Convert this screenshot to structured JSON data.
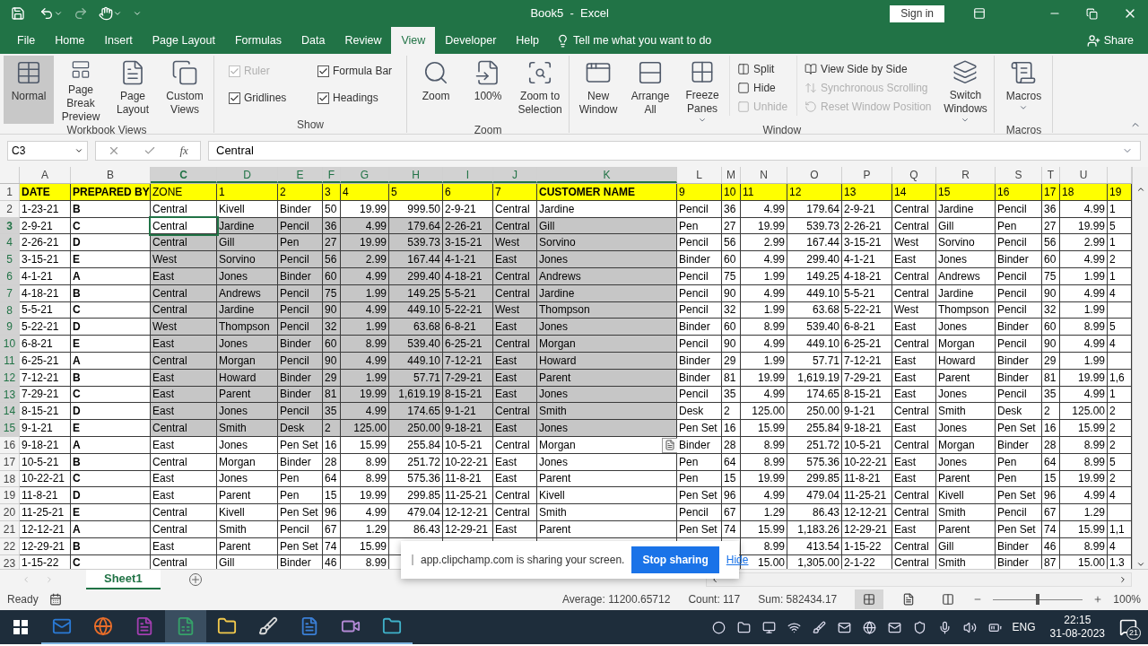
{
  "title_bar": {
    "title": "Book5  -  Excel",
    "sign_in": "Sign in"
  },
  "menu_tabs": [
    {
      "label": "File",
      "selected": false
    },
    {
      "label": "Home",
      "selected": false
    },
    {
      "label": "Insert",
      "selected": false
    },
    {
      "label": "Page Layout",
      "selected": false
    },
    {
      "label": "Formulas",
      "selected": false
    },
    {
      "label": "Data",
      "selected": false
    },
    {
      "label": "Review",
      "selected": false
    },
    {
      "label": "View",
      "selected": true
    },
    {
      "label": "Developer",
      "selected": false
    },
    {
      "label": "Help",
      "selected": false
    }
  ],
  "tell_me": "Tell me what you want to do",
  "share": "Share",
  "ribbon": [
    {
      "label": "Workbook Views",
      "items": [
        {
          "kind": "large",
          "label": "Normal",
          "selected": true
        },
        {
          "kind": "large",
          "label": "Page Break Preview",
          "selected": false
        },
        {
          "kind": "large",
          "label": "Page Layout",
          "selected": false
        },
        {
          "kind": "large",
          "label": "Custom Views",
          "selected": false
        }
      ]
    },
    {
      "label": "Show",
      "items": [
        {
          "kind": "check",
          "label": "Ruler",
          "checked": true,
          "disabled": true
        },
        {
          "kind": "check",
          "label": "Formula Bar",
          "checked": true,
          "disabled": false
        },
        {
          "kind": "check",
          "label": "Gridlines",
          "checked": true,
          "disabled": false
        },
        {
          "kind": "check",
          "label": "Headings",
          "checked": true,
          "disabled": false
        }
      ]
    },
    {
      "label": "Zoom",
      "items": [
        {
          "kind": "large",
          "label": "Zoom",
          "selected": false
        },
        {
          "kind": "large",
          "label": "100%",
          "selected": false
        },
        {
          "kind": "large",
          "label": "Zoom to Selection",
          "selected": false
        }
      ]
    },
    {
      "label": "Window",
      "items": [
        {
          "kind": "large",
          "label": "New Window",
          "selected": false
        },
        {
          "kind": "large",
          "label": "Arrange All",
          "selected": false
        },
        {
          "kind": "large",
          "label": "Freeze Panes",
          "selected": false,
          "dropdown": true
        },
        {
          "kind": "small",
          "label": "Split",
          "disabled": false
        },
        {
          "kind": "small",
          "label": "Hide",
          "disabled": false
        },
        {
          "kind": "small",
          "label": "Unhide",
          "disabled": true
        },
        {
          "kind": "small",
          "label": "View Side by Side",
          "disabled": false
        },
        {
          "kind": "small",
          "label": "Synchronous Scrolling",
          "disabled": true
        },
        {
          "kind": "small",
          "label": "Reset Window Position",
          "disabled": true
        },
        {
          "kind": "large",
          "label": "Switch Windows",
          "selected": false,
          "dropdown": true
        }
      ]
    },
    {
      "label": "Macros",
      "items": [
        {
          "kind": "large",
          "label": "Macros",
          "selected": false,
          "dropdown": true
        }
      ]
    }
  ],
  "formula_bar": {
    "name_box": "C3",
    "function_label": "fx",
    "formula": "Central"
  },
  "columns": [
    {
      "letter": "A",
      "selected": false,
      "active": false
    },
    {
      "letter": "B",
      "selected": false,
      "active": false
    },
    {
      "letter": "C",
      "selected": true,
      "active": true
    },
    {
      "letter": "D",
      "selected": true,
      "active": false
    },
    {
      "letter": "E",
      "selected": true,
      "active": false
    },
    {
      "letter": "F",
      "selected": true,
      "active": false
    },
    {
      "letter": "G",
      "selected": true,
      "active": false
    },
    {
      "letter": "H",
      "selected": true,
      "active": false
    },
    {
      "letter": "I",
      "selected": true,
      "active": false
    },
    {
      "letter": "J",
      "selected": true,
      "active": false
    },
    {
      "letter": "K",
      "selected": true,
      "active": false
    },
    {
      "letter": "L",
      "selected": false,
      "active": false
    },
    {
      "letter": "M",
      "selected": false,
      "active": false
    },
    {
      "letter": "N",
      "selected": false,
      "active": false
    },
    {
      "letter": "O",
      "selected": false,
      "active": false
    },
    {
      "letter": "P",
      "selected": false,
      "active": false
    },
    {
      "letter": "Q",
      "selected": false,
      "active": false
    },
    {
      "letter": "R",
      "selected": false,
      "active": false
    },
    {
      "letter": "S",
      "selected": false,
      "active": false
    },
    {
      "letter": "T",
      "selected": false,
      "active": false
    },
    {
      "letter": "U",
      "selected": false,
      "active": false
    }
  ],
  "rows": [
    {
      "number": "1",
      "kind": "header",
      "selected": false,
      "active": false,
      "cells": [
        "DATE",
        "PREPARED BY",
        "ZONE",
        "1",
        "2",
        "3",
        "4",
        "5",
        "6",
        "7",
        "CUSTOMER NAME",
        "9",
        "10",
        "11",
        "12",
        "13",
        "14",
        "15",
        "16",
        "17",
        "18",
        "19"
      ]
    },
    {
      "number": "2",
      "kind": "data",
      "selected": false,
      "active": false,
      "cells": [
        "1-23-21",
        "B",
        "Central",
        "Kivell",
        "Binder",
        "50",
        "19.99",
        "999.50",
        "2-9-21",
        "Central",
        "Jardine",
        "Pencil",
        "36",
        "4.99",
        "179.64",
        "2-9-21",
        "Central",
        "Jardine",
        "Pencil",
        "36",
        "4.99",
        "1"
      ]
    },
    {
      "number": "3",
      "kind": "data",
      "selected": true,
      "active": true,
      "cells": [
        "2-9-21",
        "C",
        "Central",
        "Jardine",
        "Pencil",
        "36",
        "4.99",
        "179.64",
        "2-26-21",
        "Central",
        "Gill",
        "Pen",
        "27",
        "19.99",
        "539.73",
        "2-26-21",
        "Central",
        "Gill",
        "Pen",
        "27",
        "19.99",
        "5"
      ]
    },
    {
      "number": "4",
      "kind": "data",
      "selected": true,
      "active": false,
      "cells": [
        "2-26-21",
        "D",
        "Central",
        "Gill",
        "Pen",
        "27",
        "19.99",
        "539.73",
        "3-15-21",
        "West",
        "Sorvino",
        "Pencil",
        "56",
        "2.99",
        "167.44",
        "3-15-21",
        "West",
        "Sorvino",
        "Pencil",
        "56",
        "2.99",
        "1"
      ]
    },
    {
      "number": "5",
      "kind": "data",
      "selected": true,
      "active": false,
      "cells": [
        "3-15-21",
        "E",
        "West",
        "Sorvino",
        "Pencil",
        "56",
        "2.99",
        "167.44",
        "4-1-21",
        "East",
        "Jones",
        "Binder",
        "60",
        "4.99",
        "299.40",
        "4-1-21",
        "East",
        "Jones",
        "Binder",
        "60",
        "4.99",
        "2"
      ]
    },
    {
      "number": "6",
      "kind": "data",
      "selected": true,
      "active": false,
      "cells": [
        "4-1-21",
        "A",
        "East",
        "Jones",
        "Binder",
        "60",
        "4.99",
        "299.40",
        "4-18-21",
        "Central",
        "Andrews",
        "Pencil",
        "75",
        "1.99",
        "149.25",
        "4-18-21",
        "Central",
        "Andrews",
        "Pencil",
        "75",
        "1.99",
        "1"
      ]
    },
    {
      "number": "7",
      "kind": "data",
      "selected": true,
      "active": false,
      "cells": [
        "4-18-21",
        "B",
        "Central",
        "Andrews",
        "Pencil",
        "75",
        "1.99",
        "149.25",
        "5-5-21",
        "Central",
        "Jardine",
        "Pencil",
        "90",
        "4.99",
        "449.10",
        "5-5-21",
        "Central",
        "Jardine",
        "Pencil",
        "90",
        "4.99",
        "4"
      ]
    },
    {
      "number": "8",
      "kind": "data",
      "selected": true,
      "active": false,
      "cells": [
        "5-5-21",
        "C",
        "Central",
        "Jardine",
        "Pencil",
        "90",
        "4.99",
        "449.10",
        "5-22-21",
        "West",
        "Thompson",
        "Pencil",
        "32",
        "1.99",
        "63.68",
        "5-22-21",
        "West",
        "Thompson",
        "Pencil",
        "32",
        "1.99",
        null
      ]
    },
    {
      "number": "9",
      "kind": "data",
      "selected": true,
      "active": false,
      "cells": [
        "5-22-21",
        "D",
        "West",
        "Thompson",
        "Pencil",
        "32",
        "1.99",
        "63.68",
        "6-8-21",
        "East",
        "Jones",
        "Binder",
        "60",
        "8.99",
        "539.40",
        "6-8-21",
        "East",
        "Jones",
        "Binder",
        "60",
        "8.99",
        "5"
      ]
    },
    {
      "number": "10",
      "kind": "data",
      "selected": true,
      "active": false,
      "cells": [
        "6-8-21",
        "E",
        "East",
        "Jones",
        "Binder",
        "60",
        "8.99",
        "539.40",
        "6-25-21",
        "Central",
        "Morgan",
        "Pencil",
        "90",
        "4.99",
        "449.10",
        "6-25-21",
        "Central",
        "Morgan",
        "Pencil",
        "90",
        "4.99",
        "4"
      ]
    },
    {
      "number": "11",
      "kind": "data",
      "selected": true,
      "active": false,
      "cells": [
        "6-25-21",
        "A",
        "Central",
        "Morgan",
        "Pencil",
        "90",
        "4.99",
        "449.10",
        "7-12-21",
        "East",
        "Howard",
        "Binder",
        "29",
        "1.99",
        "57.71",
        "7-12-21",
        "East",
        "Howard",
        "Binder",
        "29",
        "1.99",
        null
      ]
    },
    {
      "number": "12",
      "kind": "data",
      "selected": true,
      "active": false,
      "cells": [
        "7-12-21",
        "B",
        "East",
        "Howard",
        "Binder",
        "29",
        "1.99",
        "57.71",
        "7-29-21",
        "East",
        "Parent",
        "Binder",
        "81",
        "19.99",
        "1,619.19",
        "7-29-21",
        "East",
        "Parent",
        "Binder",
        "81",
        "19.99",
        "1,6"
      ]
    },
    {
      "number": "13",
      "kind": "data",
      "selected": true,
      "active": false,
      "cells": [
        "7-29-21",
        "C",
        "East",
        "Parent",
        "Binder",
        "81",
        "19.99",
        "1,619.19",
        "8-15-21",
        "East",
        "Jones",
        "Pencil",
        "35",
        "4.99",
        "174.65",
        "8-15-21",
        "East",
        "Jones",
        "Pencil",
        "35",
        "4.99",
        "1"
      ]
    },
    {
      "number": "14",
      "kind": "data",
      "selected": true,
      "active": false,
      "cells": [
        "8-15-21",
        "D",
        "East",
        "Jones",
        "Pencil",
        "35",
        "4.99",
        "174.65",
        "9-1-21",
        "Central",
        "Smith",
        "Desk",
        "2",
        "125.00",
        "250.00",
        "9-1-21",
        "Central",
        "Smith",
        "Desk",
        "2",
        "125.00",
        "2"
      ]
    },
    {
      "number": "15",
      "kind": "data",
      "selected": true,
      "active": false,
      "cells": [
        "9-1-21",
        "E",
        "Central",
        "Smith",
        "Desk",
        "2",
        "125.00",
        "250.00",
        "9-18-21",
        "East",
        "Jones",
        "Pen Set",
        "16",
        "15.99",
        "255.84",
        "9-18-21",
        "East",
        "Jones",
        "Pen Set",
        "16",
        "15.99",
        "2"
      ]
    },
    {
      "number": "16",
      "kind": "data",
      "selected": false,
      "active": false,
      "paste_options": true,
      "cells": [
        "9-18-21",
        "A",
        "East",
        "Jones",
        "Pen Set",
        "16",
        "15.99",
        "255.84",
        "10-5-21",
        "Central",
        "Morgan",
        "Binder",
        "28",
        "8.99",
        "251.72",
        "10-5-21",
        "Central",
        "Morgan",
        "Binder",
        "28",
        "8.99",
        "2"
      ]
    },
    {
      "number": "17",
      "kind": "data",
      "selected": false,
      "active": false,
      "cells": [
        "10-5-21",
        "B",
        "Central",
        "Morgan",
        "Binder",
        "28",
        "8.99",
        "251.72",
        "10-22-21",
        "East",
        "Jones",
        "Pen",
        "64",
        "8.99",
        "575.36",
        "10-22-21",
        "East",
        "Jones",
        "Pen",
        "64",
        "8.99",
        "5"
      ]
    },
    {
      "number": "18",
      "kind": "data",
      "selected": false,
      "active": false,
      "cells": [
        "10-22-21",
        "C",
        "East",
        "Jones",
        "Pen",
        "64",
        "8.99",
        "575.36",
        "11-8-21",
        "East",
        "Parent",
        "Pen",
        "15",
        "19.99",
        "299.85",
        "11-8-21",
        "East",
        "Parent",
        "Pen",
        "15",
        "19.99",
        "2"
      ]
    },
    {
      "number": "19",
      "kind": "data",
      "selected": false,
      "active": false,
      "cells": [
        "11-8-21",
        "D",
        "East",
        "Parent",
        "Pen",
        "15",
        "19.99",
        "299.85",
        "11-25-21",
        "Central",
        "Kivell",
        "Pen Set",
        "96",
        "4.99",
        "479.04",
        "11-25-21",
        "Central",
        "Kivell",
        "Pen Set",
        "96",
        "4.99",
        "4"
      ]
    },
    {
      "number": "20",
      "kind": "data",
      "selected": false,
      "active": false,
      "cells": [
        "11-25-21",
        "E",
        "Central",
        "Kivell",
        "Pen Set",
        "96",
        "4.99",
        "479.04",
        "12-12-21",
        "Central",
        "Smith",
        "Pencil",
        "67",
        "1.29",
        "86.43",
        "12-12-21",
        "Central",
        "Smith",
        "Pencil",
        "67",
        "1.29",
        null
      ]
    },
    {
      "number": "21",
      "kind": "data",
      "selected": false,
      "active": false,
      "cells": [
        "12-12-21",
        "A",
        "Central",
        "Smith",
        "Pencil",
        "67",
        "1.29",
        "86.43",
        "12-29-21",
        "East",
        "Parent",
        "Pen Set",
        "74",
        "15.99",
        "1,183.26",
        "12-29-21",
        "East",
        "Parent",
        "Pen Set",
        "74",
        "15.99",
        "1,1"
      ]
    },
    {
      "number": "22",
      "kind": "data",
      "selected": false,
      "active": false,
      "cells": [
        "12-29-21",
        "B",
        "East",
        "Parent",
        "Pen Set",
        "74",
        "15.99",
        null,
        null,
        null,
        null,
        null,
        null,
        "8.99",
        "413.54",
        "1-15-22",
        "Central",
        "Gill",
        "Binder",
        "46",
        "8.99",
        "4"
      ]
    },
    {
      "number": "23",
      "kind": "data",
      "selected": false,
      "active": false,
      "cells": [
        "1-15-22",
        "C",
        "Central",
        "Gill",
        "Binder",
        "46",
        "8.99",
        null,
        null,
        null,
        null,
        null,
        null,
        "15.00",
        "1,305.00",
        "2-1-22",
        "Central",
        "Smith",
        "Binder",
        "87",
        "15.00",
        "1.3"
      ]
    }
  ],
  "sheet_tabs": [
    {
      "label": "Sheet1",
      "selected": true
    }
  ],
  "share_popup": {
    "message": "app.clipchamp.com is sharing your screen.",
    "stop": "Stop sharing",
    "hide": "Hide"
  },
  "status_bar": {
    "state": "Ready",
    "stats": [
      "Average: 11200.65712",
      "Count: 117",
      "Sum: 582434.17"
    ],
    "views": [
      {
        "kind": "normal",
        "selected": true
      },
      {
        "kind": "layout",
        "selected": false
      },
      {
        "kind": "pagebreak",
        "selected": false
      }
    ],
    "zoom": "100%",
    "level": 0.5
  },
  "taskbar": {
    "apps": [
      {
        "kind": "mail",
        "selected": false
      },
      {
        "kind": "browser",
        "selected": false
      },
      {
        "kind": "notebook",
        "selected": false
      },
      {
        "kind": "sheet",
        "selected": true
      },
      {
        "kind": "folder",
        "selected": false
      },
      {
        "kind": "brush",
        "selected": false
      },
      {
        "kind": "doc",
        "selected": false
      },
      {
        "kind": "video",
        "selected": false
      },
      {
        "kind": "files",
        "selected": false
      }
    ],
    "language": "ENG",
    "time": "22:15",
    "date": "31-08-2023",
    "notifications": "21"
  }
}
